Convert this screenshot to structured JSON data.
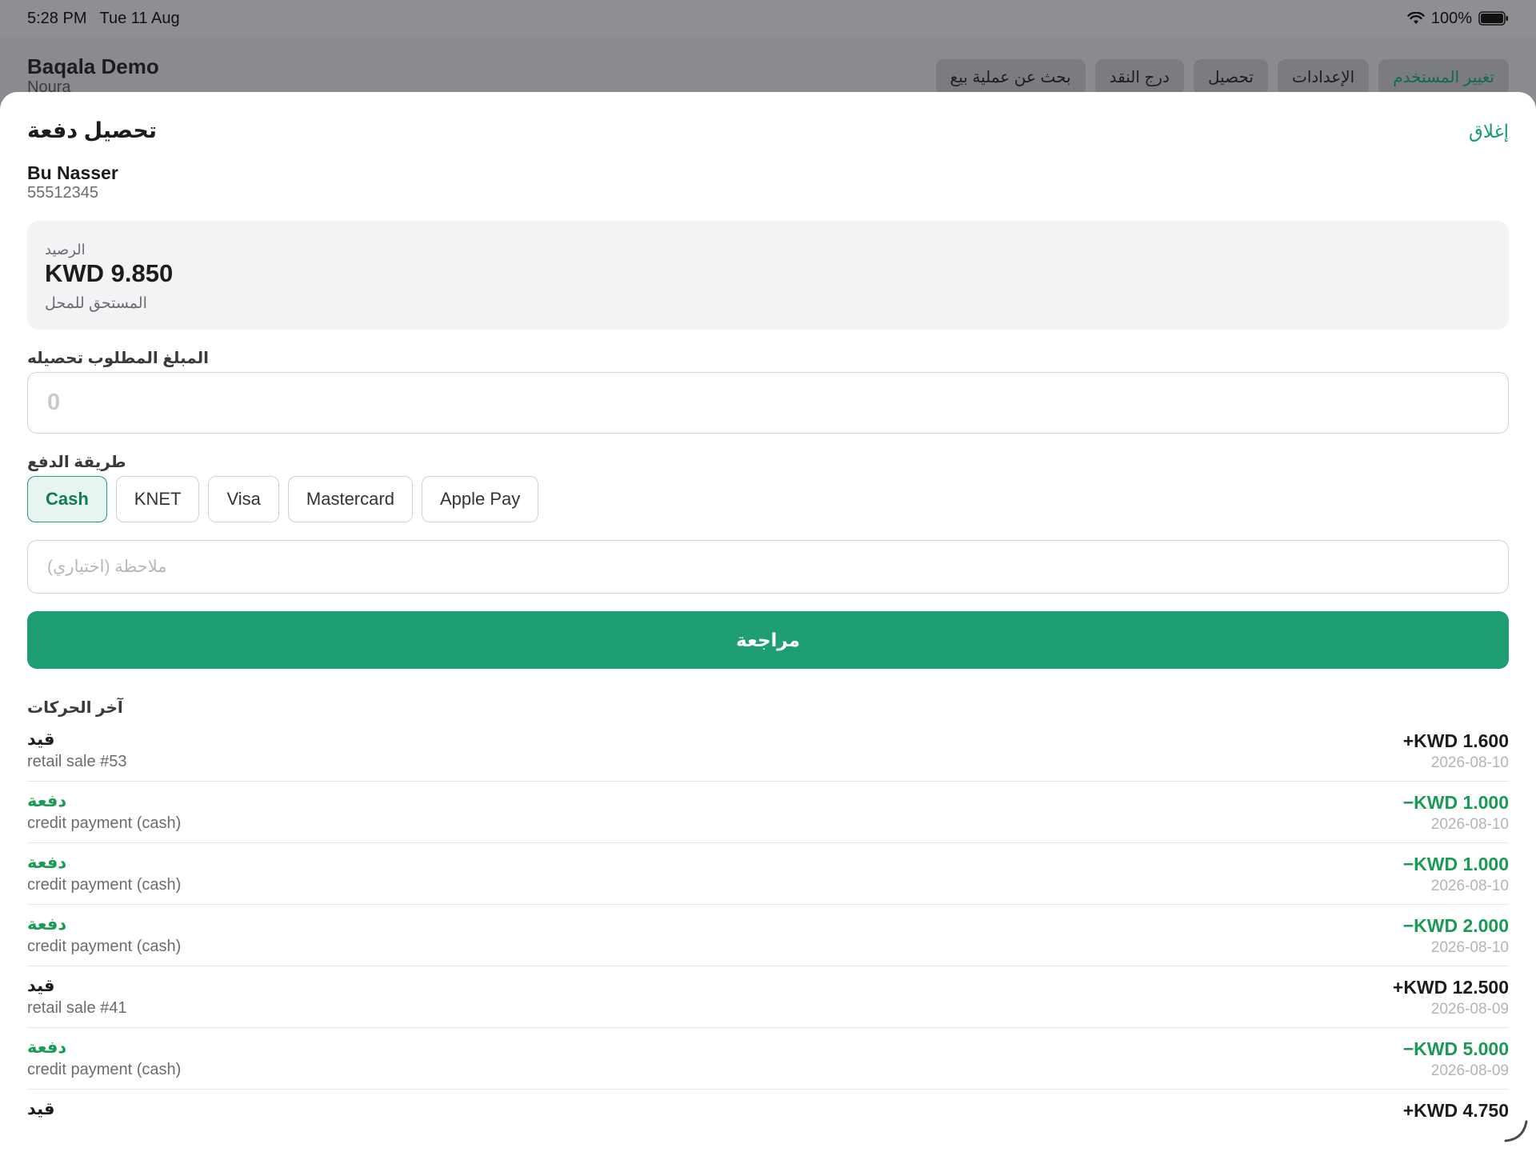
{
  "status_bar": {
    "time": "5:28 PM",
    "date": "Tue 11 Aug",
    "battery": "100%"
  },
  "background_app": {
    "store_name": "Baqala Demo",
    "user_name": "Noura",
    "tabs": [
      {
        "label": "تغيير المستخدم",
        "accent": true
      },
      {
        "label": "الإعدادات"
      },
      {
        "label": "تحصيل"
      },
      {
        "label": "درج النقد"
      },
      {
        "label": "بحث عن عملية بيع"
      }
    ]
  },
  "sheet": {
    "title": "تحصيل دفعة",
    "close_label": "إغلاق",
    "customer": {
      "name": "Bu Nasser",
      "phone": "55512345"
    },
    "balance": {
      "label": "الرصيد",
      "amount": "KWD 9.850",
      "subtitle": "المستحق للمحل"
    },
    "amount_field": {
      "label": "المبلغ المطلوب تحصيله",
      "value": "",
      "placeholder": "0"
    },
    "payment_method": {
      "label": "طريقة الدفع",
      "selected": "Cash",
      "options": [
        "Cash",
        "KNET",
        "Visa",
        "Mastercard",
        "Apple Pay"
      ]
    },
    "note_field": {
      "value": "",
      "placeholder": "ملاحظة (اختياري)"
    },
    "review_label": "مراجعة",
    "recent_title": "آخر الحركات",
    "transactions": [
      {
        "type": "قيد",
        "kind": "charge",
        "desc": "retail sale #53",
        "amount": "+KWD 1.600",
        "date": "2026-08-10"
      },
      {
        "type": "دفعة",
        "kind": "payment",
        "desc": "credit payment (cash)",
        "amount": "−KWD 1.000",
        "date": "2026-08-10"
      },
      {
        "type": "دفعة",
        "kind": "payment",
        "desc": "credit payment (cash)",
        "amount": "−KWD 1.000",
        "date": "2026-08-10"
      },
      {
        "type": "دفعة",
        "kind": "payment",
        "desc": "credit payment (cash)",
        "amount": "−KWD 2.000",
        "date": "2026-08-10"
      },
      {
        "type": "قيد",
        "kind": "charge",
        "desc": "retail sale #41",
        "amount": "+KWD 12.500",
        "date": "2026-08-09"
      },
      {
        "type": "دفعة",
        "kind": "payment",
        "desc": "credit payment (cash)",
        "amount": "−KWD 5.000",
        "date": "2026-08-09"
      },
      {
        "type": "قيد",
        "kind": "charge",
        "desc": "",
        "amount": "+KWD 4.750",
        "date": ""
      }
    ]
  },
  "colors": {
    "accent": "#1f9e73",
    "payment": "#1a9a55",
    "dim_overlay": "#8e8f93"
  }
}
